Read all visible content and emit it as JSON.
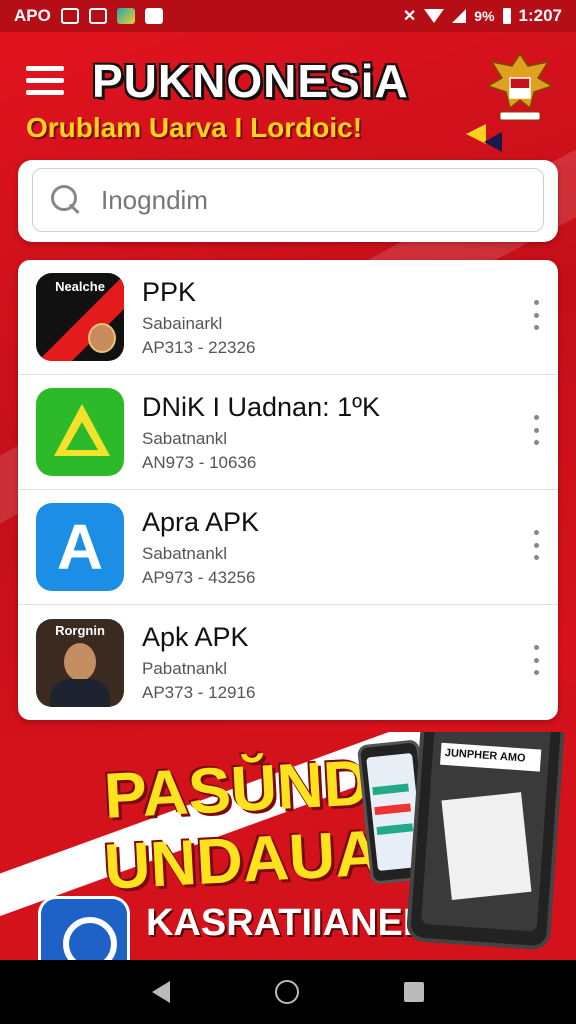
{
  "status_bar": {
    "carrier": "APO",
    "battery_pct": "9%",
    "time": "1:207"
  },
  "header": {
    "title": "PUKNONESiA",
    "tagline": "Orublam Uarva I Lordoic!"
  },
  "search": {
    "placeholder": "Inogndim"
  },
  "apps": [
    {
      "icon_label": "Nealche",
      "title": "PPK",
      "subtitle": "Sabainarkl",
      "meta": "AP313 - 22326"
    },
    {
      "title": "DNiK  I Uadnan:  1ºK",
      "subtitle": "Sabatnankl",
      "meta": "AN973 - 10636"
    },
    {
      "title": "Apra APK",
      "subtitle": "Sabatnankl",
      "meta": "AP973 - 43256"
    },
    {
      "icon_label": "Rorgnin",
      "title": "Apk APK",
      "subtitle": "Pabatnankl",
      "meta": "AP373 - 12916"
    }
  ],
  "promo": {
    "line1": "PASŬND",
    "line2": "UNDAUA!",
    "subline": "KASRATIIANEKYI",
    "phone_banner": "JUNPHER AMO"
  },
  "colors": {
    "primary_red": "#d4121c",
    "accent_yellow": "#ffd21f"
  }
}
